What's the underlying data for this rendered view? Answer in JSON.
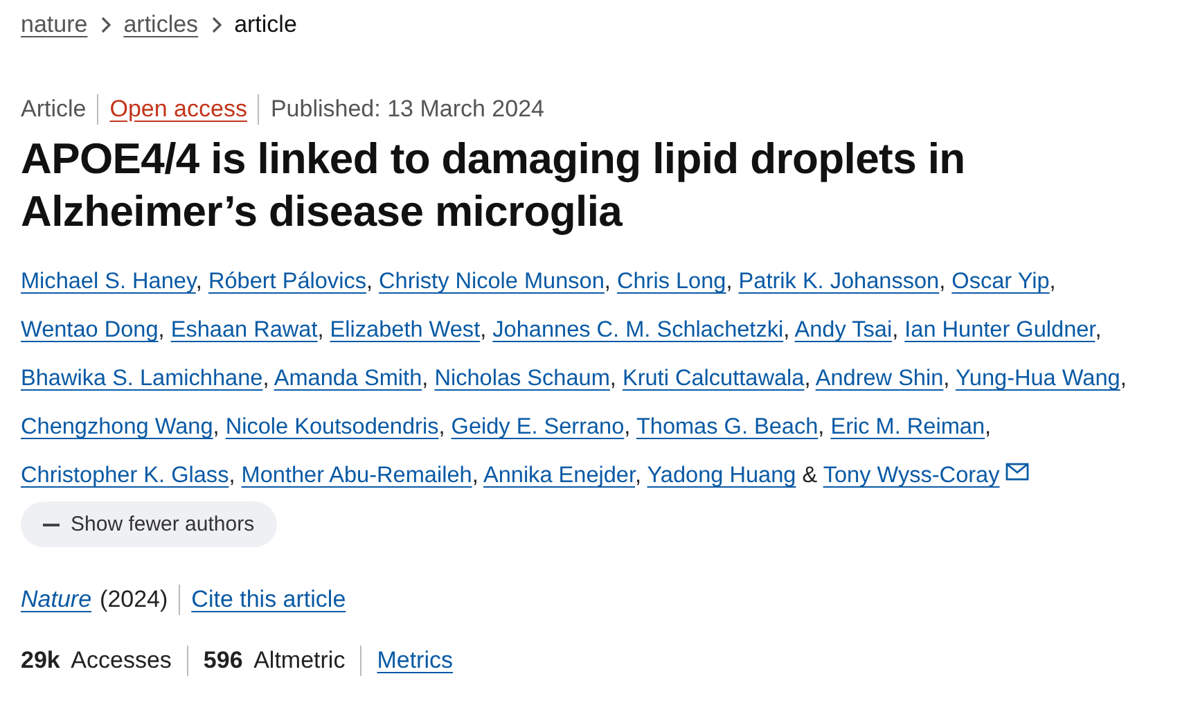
{
  "breadcrumb": [
    {
      "label": "nature",
      "link": true
    },
    {
      "label": "articles",
      "link": true
    },
    {
      "label": "article",
      "link": false
    }
  ],
  "meta": {
    "type": "Article",
    "access": "Open access",
    "published": "Published: 13 March 2024"
  },
  "title": "APOE4/4 is linked to damaging lipid droplets in Alzheimer’s disease microglia",
  "authors": [
    {
      "name": "Michael S. Haney",
      "sep": ","
    },
    {
      "name": "Róbert Pálovics",
      "sep": ","
    },
    {
      "name": "Christy Nicole Munson",
      "sep": ","
    },
    {
      "name": "Chris Long",
      "sep": ","
    },
    {
      "name": "Patrik K. Johansson",
      "sep": ","
    },
    {
      "name": "Oscar Yip",
      "sep": ","
    },
    {
      "name": "Wentao Dong",
      "sep": ","
    },
    {
      "name": "Eshaan Rawat",
      "sep": ","
    },
    {
      "name": "Elizabeth West",
      "sep": ","
    },
    {
      "name": "Johannes C. M. Schlachetzki",
      "sep": ","
    },
    {
      "name": "Andy Tsai",
      "sep": ","
    },
    {
      "name": "Ian Hunter Guldner",
      "sep": ","
    },
    {
      "name": "Bhawika S. Lamichhane",
      "sep": ","
    },
    {
      "name": "Amanda Smith",
      "sep": ","
    },
    {
      "name": "Nicholas Schaum",
      "sep": ","
    },
    {
      "name": "Kruti Calcuttawala",
      "sep": ","
    },
    {
      "name": "Andrew Shin",
      "sep": ","
    },
    {
      "name": "Yung-Hua Wang",
      "sep": ","
    },
    {
      "name": "Chengzhong Wang",
      "sep": ","
    },
    {
      "name": "Nicole Koutsodendris",
      "sep": ","
    },
    {
      "name": "Geidy E. Serrano",
      "sep": ","
    },
    {
      "name": "Thomas G. Beach",
      "sep": ","
    },
    {
      "name": "Eric M. Reiman",
      "sep": ","
    },
    {
      "name": "Christopher K. Glass",
      "sep": ","
    },
    {
      "name": "Monther Abu-Remaileh",
      "sep": ","
    },
    {
      "name": "Annika Enejder",
      "sep": ","
    },
    {
      "name": "Yadong Huang",
      "sep": " &"
    },
    {
      "name": "Tony Wyss-Coray",
      "contact": true
    }
  ],
  "toggle_authors": "Show fewer authors",
  "citation": {
    "journal": "Nature",
    "year": "(2024)",
    "cite": "Cite this article"
  },
  "metrics": [
    "**29k** Accesses",
    "**596** Altmetric"
  ],
  "metrics_link": "Metrics"
}
